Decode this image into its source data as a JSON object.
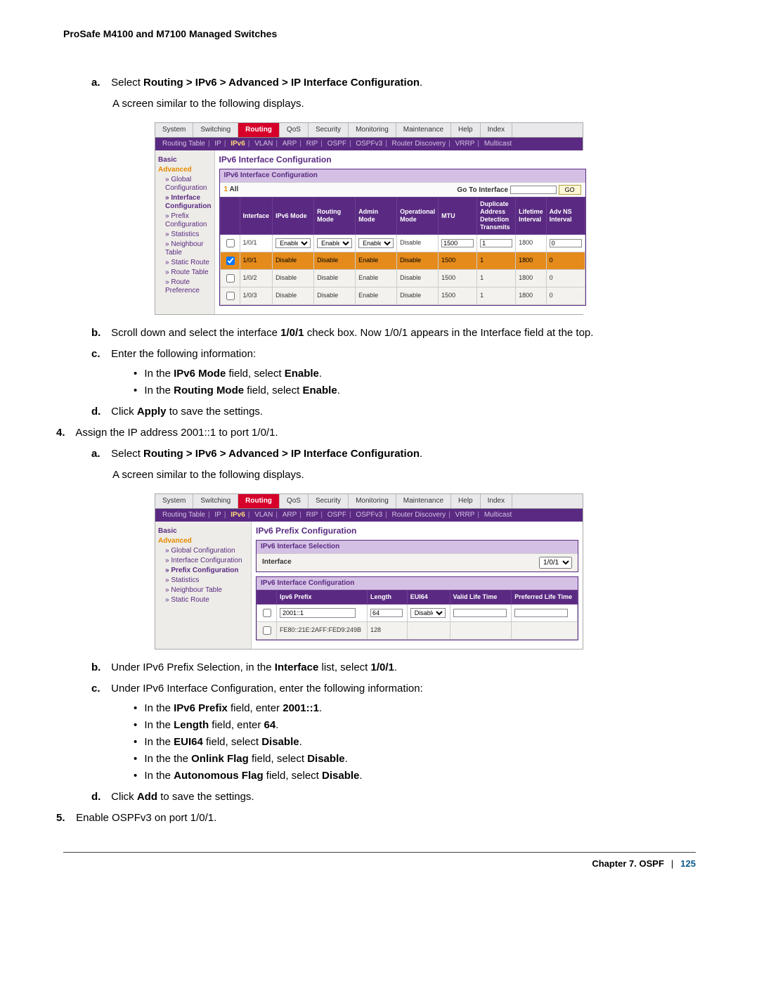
{
  "document": {
    "header": "ProSafe M4100 and M7100 Managed Switches",
    "footer_chapter": "Chapter 7.  OSPF",
    "footer_page": "125"
  },
  "steps": {
    "a1_prefix": "a.",
    "a1_text1": "Select ",
    "a1_bold": "Routing > IPv6 > Advanced > IP Interface Configuration",
    "a1_followup": "A screen similar to the following displays.",
    "b1_prefix": "b.",
    "b1_text": "Scroll down and select the interface ",
    "b1_bold": "1/0/1",
    "b1_tail": " check box. Now 1/0/1 appears in the Interface field at the top.",
    "c1_prefix": "c.",
    "c1_text": "Enter the following information:",
    "c1_b1_a": "In the ",
    "c1_b1_b": "IPv6 Mode",
    "c1_b1_c": " field, select ",
    "c1_b1_d": "Enable",
    "c1_b2_b": "Routing Mode",
    "d1_prefix": "d.",
    "d1_a": "Click ",
    "d1_b": "Apply",
    "d1_c": " to save the settings.",
    "n4_prefix": "4.",
    "n4_text": "Assign the IP address 2001::1 to port 1/0/1.",
    "a2_prefix": "a.",
    "a2_text1": "Select ",
    "a2_bold": "Routing > IPv6 > Advanced > IP Interface Configuration",
    "a2_followup": "A screen similar to the following displays.",
    "b2_prefix": "b.",
    "b2_a": "Under IPv6 Prefix Selection, in the ",
    "b2_b": "Interface",
    "b2_c": " list, select ",
    "b2_d": "1/0/1",
    "c2_prefix": "c.",
    "c2_text": "Under IPv6 Interface Configuration, enter the following information:",
    "c2_b1_a": "In the ",
    "c2_b1_b": "IPv6 Prefix",
    "c2_b1_c": " field, enter ",
    "c2_b1_d": "2001::1",
    "c2_b2_b": "Length",
    "c2_b2_d": "64",
    "c2_b3_b": "EUI64",
    "c2_b3_c": " field, select ",
    "c2_b3_d": "Disable",
    "c2_b4_a": "In the the ",
    "c2_b4_b": "Onlink Flag",
    "c2_b5_b": "Autonomous Flag",
    "d2_prefix": "d.",
    "d2_a": "Click ",
    "d2_b": "Add",
    "d2_c": " to save the settings.",
    "n5_prefix": "5.",
    "n5_text": " Enable OSPFv3 on port 1/0/1."
  },
  "app1": {
    "tabs": [
      "System",
      "Switching",
      "Routing",
      "QoS",
      "Security",
      "Monitoring",
      "Maintenance",
      "Help",
      "Index"
    ],
    "subtabs": [
      "Routing Table",
      "IP",
      "IPv6",
      "VLAN",
      "ARP",
      "RIP",
      "OSPF",
      "OSPFv3",
      "Router Discovery",
      "VRRP",
      "Multicast"
    ],
    "sidebar": {
      "basic": "Basic",
      "advanced": "Advanced",
      "items": [
        "Global Configuration",
        "Interface Configuration",
        "Prefix Configuration",
        "Statistics",
        "Neighbour Table",
        "Static Route",
        "Route Table",
        "Route Preference"
      ]
    },
    "panel_title": "IPv6 Interface Configuration",
    "inner_title": "IPv6 Interface Configuration",
    "all_label": "All",
    "go_label_a": "Go To Interface",
    "go_btn": "GO",
    "headers": [
      "",
      "Interface",
      "IPv6 Mode",
      "Routing Mode",
      "Admin Mode",
      "Operational Mode",
      "MTU",
      "Duplicate Address Detection Transmits",
      "Lifetime Interval",
      "Adv NS Interval"
    ],
    "rows": [
      {
        "chk": "☑",
        "iface": "1/0/1",
        "ipv6": "Enable",
        "routing": "Enable",
        "admin": "Enable",
        "oper": "Disable",
        "mtu": "1500",
        "dad": "1",
        "life": "1800",
        "adv": "0",
        "cls": "input-row"
      },
      {
        "chk": "☑",
        "iface": "1/0/1",
        "ipv6": "Disable",
        "routing": "Disable",
        "admin": "Enable",
        "oper": "Disable",
        "mtu": "1500",
        "dad": "1",
        "life": "1800",
        "adv": "0",
        "cls": "selected"
      },
      {
        "chk": "☐",
        "iface": "1/0/2",
        "ipv6": "Disable",
        "routing": "Disable",
        "admin": "Enable",
        "oper": "Disable",
        "mtu": "1500",
        "dad": "1",
        "life": "1800",
        "adv": "0",
        "cls": ""
      },
      {
        "chk": "☐",
        "iface": "1/0/3",
        "ipv6": "Disable",
        "routing": "Disable",
        "admin": "Enable",
        "oper": "Disable",
        "mtu": "1500",
        "dad": "1",
        "life": "1800",
        "adv": "0",
        "cls": ""
      }
    ]
  },
  "app2": {
    "tabs": [
      "System",
      "Switching",
      "Routing",
      "QoS",
      "Security",
      "Monitoring",
      "Maintenance",
      "Help",
      "Index"
    ],
    "subtabs": [
      "Routing Table",
      "IP",
      "IPv6",
      "VLAN",
      "ARP",
      "RIP",
      "OSPF",
      "OSPFv3",
      "Router Discovery",
      "VRRP",
      "Multicast"
    ],
    "sidebar": {
      "basic": "Basic",
      "advanced": "Advanced",
      "items": [
        "Global Configuration",
        "Interface Configuration",
        "Prefix Configuration",
        "Statistics",
        "Neighbour Table",
        "Static Route"
      ]
    },
    "panel_title": "IPv6 Prefix Configuration",
    "sel_title": "IPv6 Interface Selection",
    "iface_label": "Interface",
    "iface_value": "1/0/1",
    "cfg_title": "IPv6 Interface Configuration",
    "headers": [
      "",
      "Ipv6 Prefix",
      "Length",
      "EUI64",
      "Valid Life Time",
      "Preferred Life Time"
    ],
    "rows": [
      {
        "chk": "■",
        "prefix": "2001::1",
        "len": "64",
        "eui": "Disable",
        "valid": "",
        "pref": "",
        "cls": "input-row"
      },
      {
        "chk": "☐",
        "prefix": "FE80::21E:2AFF:FED9:249B",
        "len": "128",
        "eui": "",
        "valid": "",
        "pref": "",
        "cls": ""
      }
    ]
  }
}
